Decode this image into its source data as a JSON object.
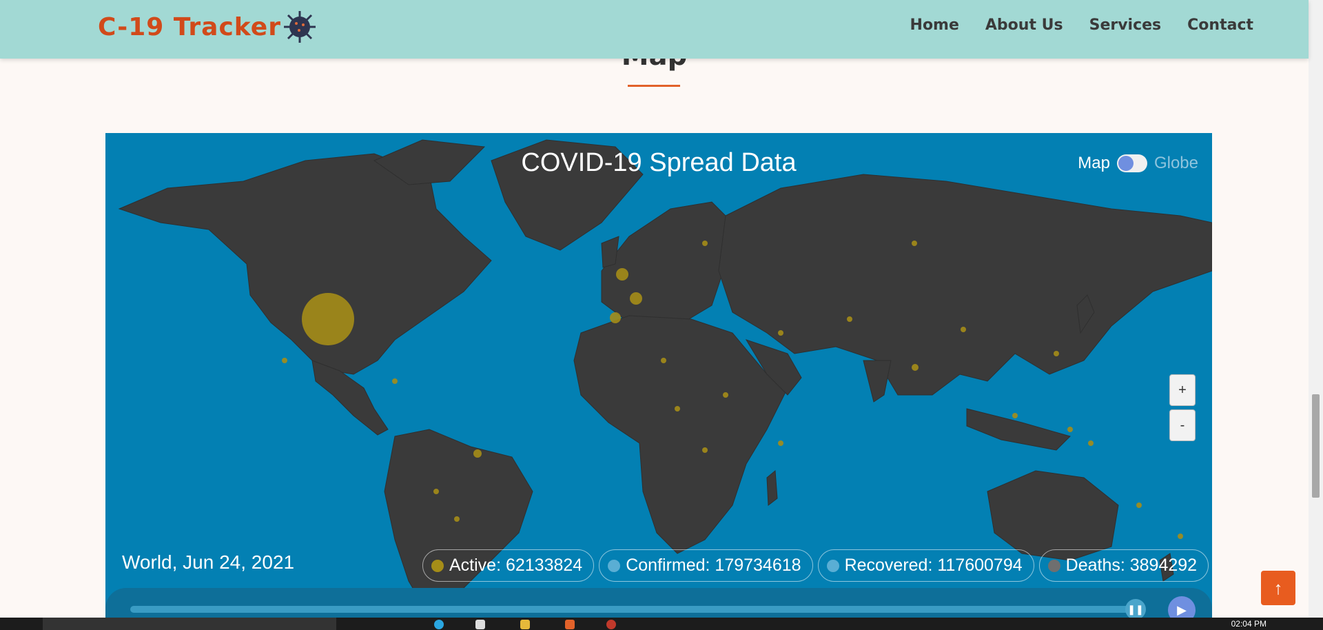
{
  "header": {
    "logo_text": "C-19 Tracker",
    "nav": [
      "Home",
      "About Us",
      "Services",
      "Contact"
    ]
  },
  "section": {
    "title": "Map"
  },
  "map": {
    "title": "COVID-19 Spread Data",
    "toggle": {
      "left_label": "Map",
      "right_label": "Globe",
      "selected": "Map"
    },
    "zoom_in": "+",
    "zoom_out": "-",
    "location_date": "World, Jun 24, 2021",
    "stats": [
      {
        "label": "Active: 62133824",
        "color": "#a58d18"
      },
      {
        "label": "Confirmed: 179734618",
        "color": "#5aaed4"
      },
      {
        "label": "Recovered: 117600794",
        "color": "#5aaed4"
      },
      {
        "label": "Deaths: 3894292",
        "color": "#6f6f6f"
      }
    ],
    "colors": {
      "ocean": "#0380b3",
      "land": "#3a3a3a",
      "bubble": "#a58d18"
    }
  },
  "scroll_top_icon": "arrow-up-icon",
  "taskbar": {
    "time": "02:04 PM"
  }
}
